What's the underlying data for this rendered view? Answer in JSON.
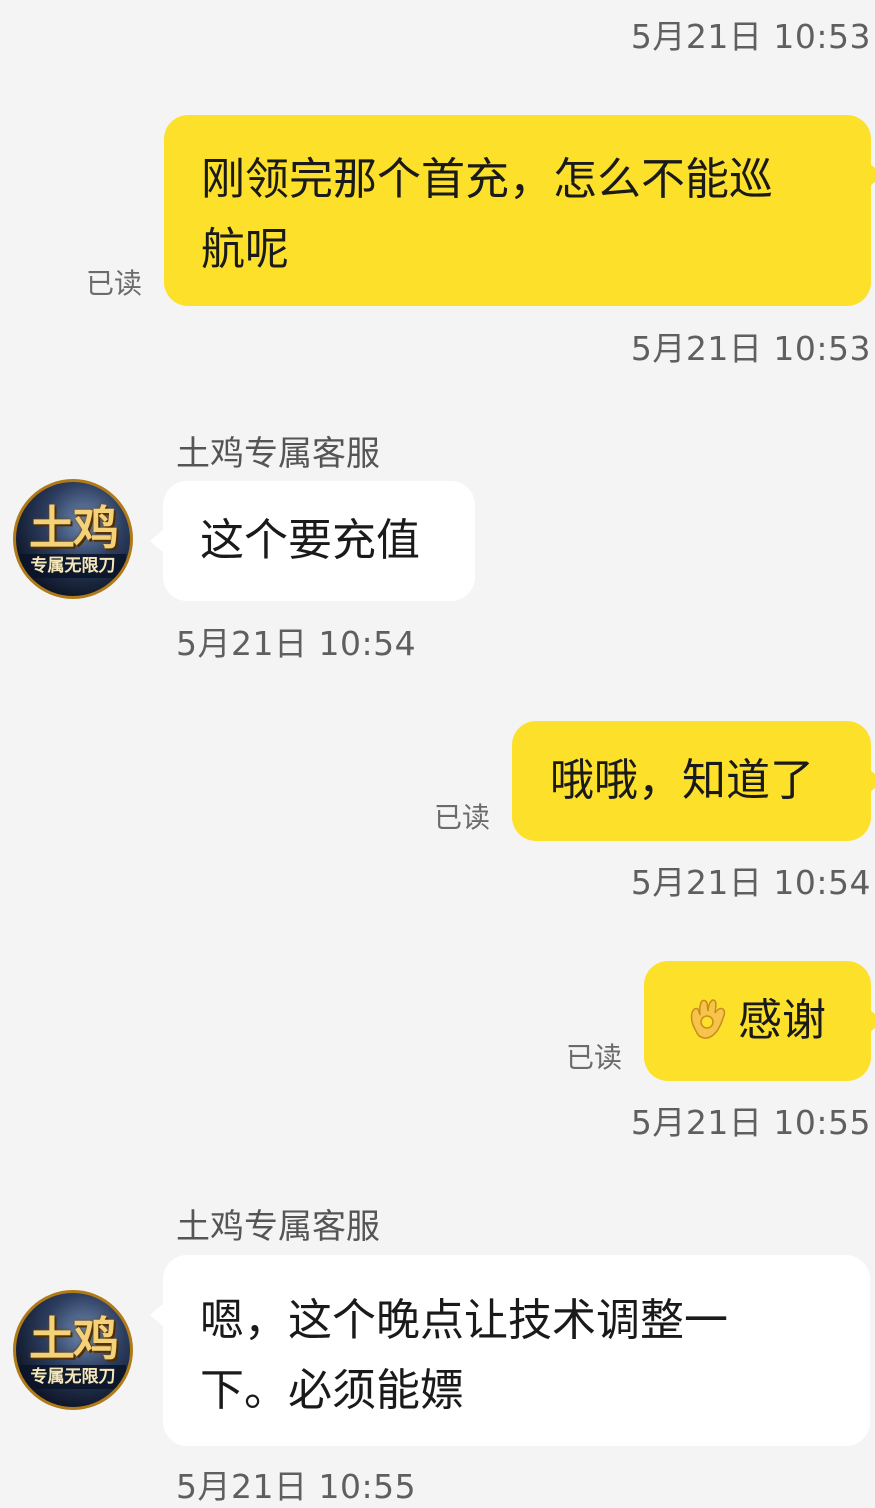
{
  "messages": [
    {
      "type": "timestamp",
      "text": "5月21日 10:53"
    },
    {
      "type": "sent",
      "text_line1": "刚领完那个首充，怎么不能巡",
      "text_line2": "航呢",
      "read": "已读"
    },
    {
      "type": "timestamp",
      "text": "5月21日 10:53"
    },
    {
      "type": "received",
      "sender": "土鸡专属客服",
      "text": "这个要充值"
    },
    {
      "type": "timestamp",
      "text": "5月21日 10:54"
    },
    {
      "type": "sent",
      "text": "哦哦，知道了",
      "read": "已读"
    },
    {
      "type": "timestamp",
      "text": "5月21日 10:54"
    },
    {
      "type": "sent",
      "emoji_icon": "ok-hand-icon",
      "text": "感谢",
      "read": "已读"
    },
    {
      "type": "timestamp",
      "text": "5月21日 10:55"
    },
    {
      "type": "received",
      "sender": "土鸡专属客服",
      "text_line1": "嗯，这个晚点让技术调整一",
      "text_line2": "下。必须能嫖"
    },
    {
      "type": "timestamp",
      "text": "5月21日 10:55"
    }
  ],
  "avatar": {
    "main_text": "土鸡",
    "sub_text": "专属无限刀"
  },
  "colors": {
    "background": "#f4f4f4",
    "sent_bubble": "#fde02a",
    "received_bubble": "#ffffff"
  }
}
